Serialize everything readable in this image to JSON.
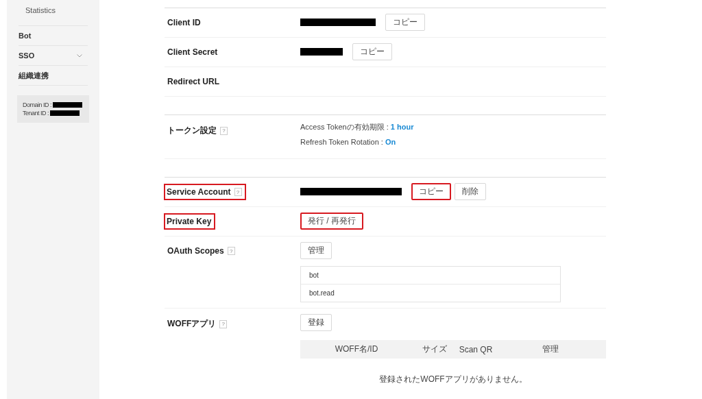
{
  "sidebar": {
    "items": [
      {
        "label": "Statistics",
        "kind": "sub"
      },
      {
        "label": "Bot",
        "kind": "main"
      },
      {
        "label": "SSO",
        "kind": "expandable"
      },
      {
        "label": "組織連携",
        "kind": "main"
      }
    ],
    "info": [
      {
        "label": "Domain ID :",
        "redacted": true
      },
      {
        "label": "Tenant ID :",
        "redacted": true
      }
    ]
  },
  "sections": [
    {
      "rows": [
        {
          "label": "Client ID",
          "highlighted": false,
          "content": [
            {
              "kind": "redacted"
            },
            {
              "kind": "button",
              "label": "コピー",
              "highlighted": false
            }
          ]
        },
        {
          "label": "Client Secret",
          "highlighted": false,
          "content": [
            {
              "kind": "redacted"
            },
            {
              "kind": "button",
              "label": "コピー",
              "highlighted": false
            }
          ]
        },
        {
          "label": "Redirect URL",
          "highlighted": false,
          "content": []
        }
      ]
    },
    {
      "rows": [
        {
          "label": "トークン設定",
          "help": "?",
          "highlighted": false,
          "content": [
            {
              "kind": "setting",
              "label": "Access Tokenの有効期限 : ",
              "value": "1 hour"
            },
            {
              "kind": "setting",
              "label": "Refresh Token Rotation : ",
              "value": "On"
            }
          ]
        }
      ]
    },
    {
      "rows": [
        {
          "label": "Service Account",
          "help": "?",
          "highlighted": true,
          "content": [
            {
              "kind": "redacted"
            },
            {
              "kind": "button",
              "label": "コピー",
              "highlighted": true
            },
            {
              "kind": "button",
              "label": "削除",
              "highlighted": false
            }
          ]
        },
        {
          "label": "Private Key",
          "highlighted": true,
          "content": [
            {
              "kind": "button",
              "label": "発行 / 再発行",
              "highlighted": true
            }
          ]
        },
        {
          "label": "OAuth Scopes",
          "help": "?",
          "highlighted": false,
          "content": [
            {
              "kind": "button",
              "label": "管理",
              "highlighted": false
            },
            {
              "kind": "list",
              "items": [
                "bot",
                "bot.read"
              ]
            }
          ]
        },
        {
          "label": "WOFFアプリ",
          "help": "?",
          "highlighted": false,
          "content": [
            {
              "kind": "button",
              "label": "登録",
              "highlighted": false
            },
            {
              "kind": "table",
              "columns": [
                "WOFF名/ID",
                "サイズ",
                "Scan QR",
                "管理"
              ],
              "empty": "登録されたWOFFアプリがありません。"
            }
          ]
        }
      ]
    }
  ]
}
